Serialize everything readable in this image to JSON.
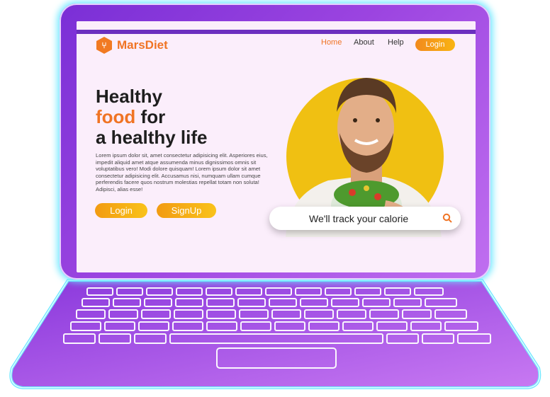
{
  "brand": {
    "name": "MarsDiet",
    "accent": "#f07424"
  },
  "nav": {
    "home": "Home",
    "about": "About",
    "help": "Help",
    "login": "Login"
  },
  "hero": {
    "line1": "Healthy",
    "line2_accent": "food",
    "line2_rest": " for",
    "line3": "a healthy life",
    "body": "Lorem ipsum dolor sit, amet consectetur adipisicing elit. Asperiores eius, impedit aliquid amet atque assumenda minus dignissimos omnis sit voluptatibus vero! Modi dolore quisquam! Lorem ipsum dolor sit amet consectetur adipisicing elit. Accusamus nisi, numquam ullam cumque perferendis facere quos nostrum molestias repellat totam non soluta! Adipisci, alias esse!",
    "login_button": "Login",
    "signup_button": "SignUp"
  },
  "search": {
    "placeholder": "We'll track your calorie",
    "icon": "search-icon"
  },
  "colors": {
    "frame": "#8b3be0",
    "screen_bg": "#fbeefb",
    "sun": "#f0c012",
    "glow": "#6ee8ff"
  }
}
